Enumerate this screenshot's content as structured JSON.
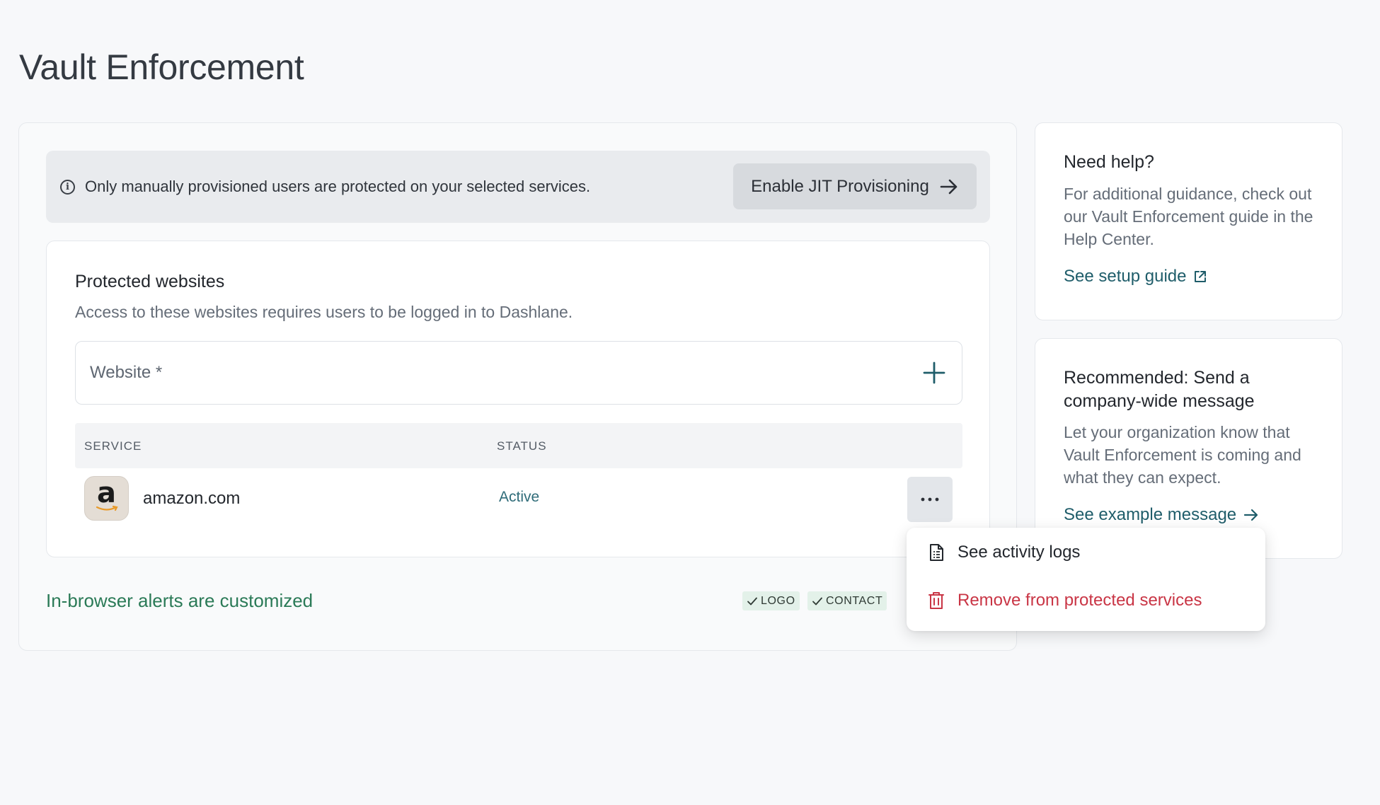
{
  "page": {
    "title": "Vault Enforcement"
  },
  "banner": {
    "icon": "info-icon",
    "text": "Only manually provisioned users are protected on your selected services.",
    "button_label": "Enable JIT Provisioning"
  },
  "websites": {
    "title": "Protected websites",
    "description": "Access to these websites requires users to be logged in to Dashlane.",
    "input_placeholder": "Website *",
    "table": {
      "columns": [
        "SERVICE",
        "STATUS"
      ],
      "rows": [
        {
          "logo_letter": "a",
          "service": "amazon.com",
          "status": "Active"
        }
      ]
    }
  },
  "alerts": {
    "text": "In-browser alerts are customized",
    "badges": [
      "LOGO",
      "CONTACT"
    ]
  },
  "help_card": {
    "title": "Need help?",
    "description": "For additional guidance, check out our Vault Enforcement guide in the Help Center.",
    "link": "See setup guide"
  },
  "recommend_card": {
    "title": "Recommended: Send a company-wide message",
    "description": "Let your organization know that Vault Enforcement is coming and what they can expect.",
    "link": "See example message"
  },
  "menu": {
    "items": [
      {
        "label": "See activity logs",
        "icon": "document-icon"
      },
      {
        "label": "Remove from protected services",
        "icon": "trash-icon"
      }
    ]
  },
  "colors": {
    "accent_teal": "#1f5d6a",
    "success_green": "#2b7a57",
    "danger_red": "#c93545",
    "status_active": "#2f6c79"
  }
}
